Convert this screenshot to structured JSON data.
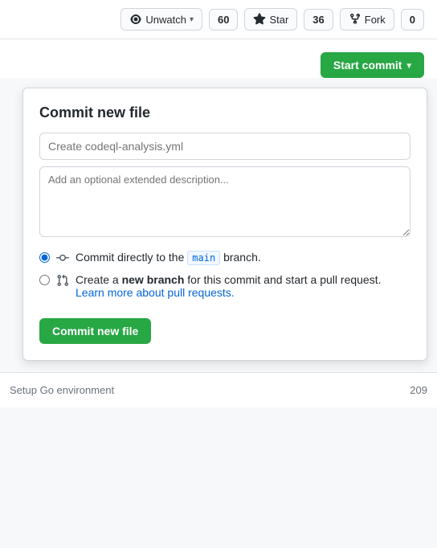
{
  "topbar": {
    "watch_label": "Unwatch",
    "watch_count": "60",
    "star_label": "Star",
    "star_count": "36",
    "fork_label": "Fork",
    "fork_count": "0"
  },
  "commit_button": {
    "label": "Start commit",
    "chevron": "▾"
  },
  "modal": {
    "title": "Commit new file",
    "commit_message_value": "Create codeql-analysis.yml",
    "commit_message_placeholder": "Create codeql-analysis.yml",
    "description_placeholder": "Add an optional extended description...",
    "radio_direct_label": "Commit directly to the",
    "branch_name": "main",
    "radio_direct_suffix": "branch.",
    "radio_branch_label": "Create a",
    "radio_branch_bold": "new branch",
    "radio_branch_mid": "for this commit and start a pull request.",
    "radio_branch_link": "Learn more about pull requests.",
    "commit_btn_label": "Commit new file"
  },
  "bottom": {
    "text": "Setup Go environment",
    "count": "209"
  }
}
